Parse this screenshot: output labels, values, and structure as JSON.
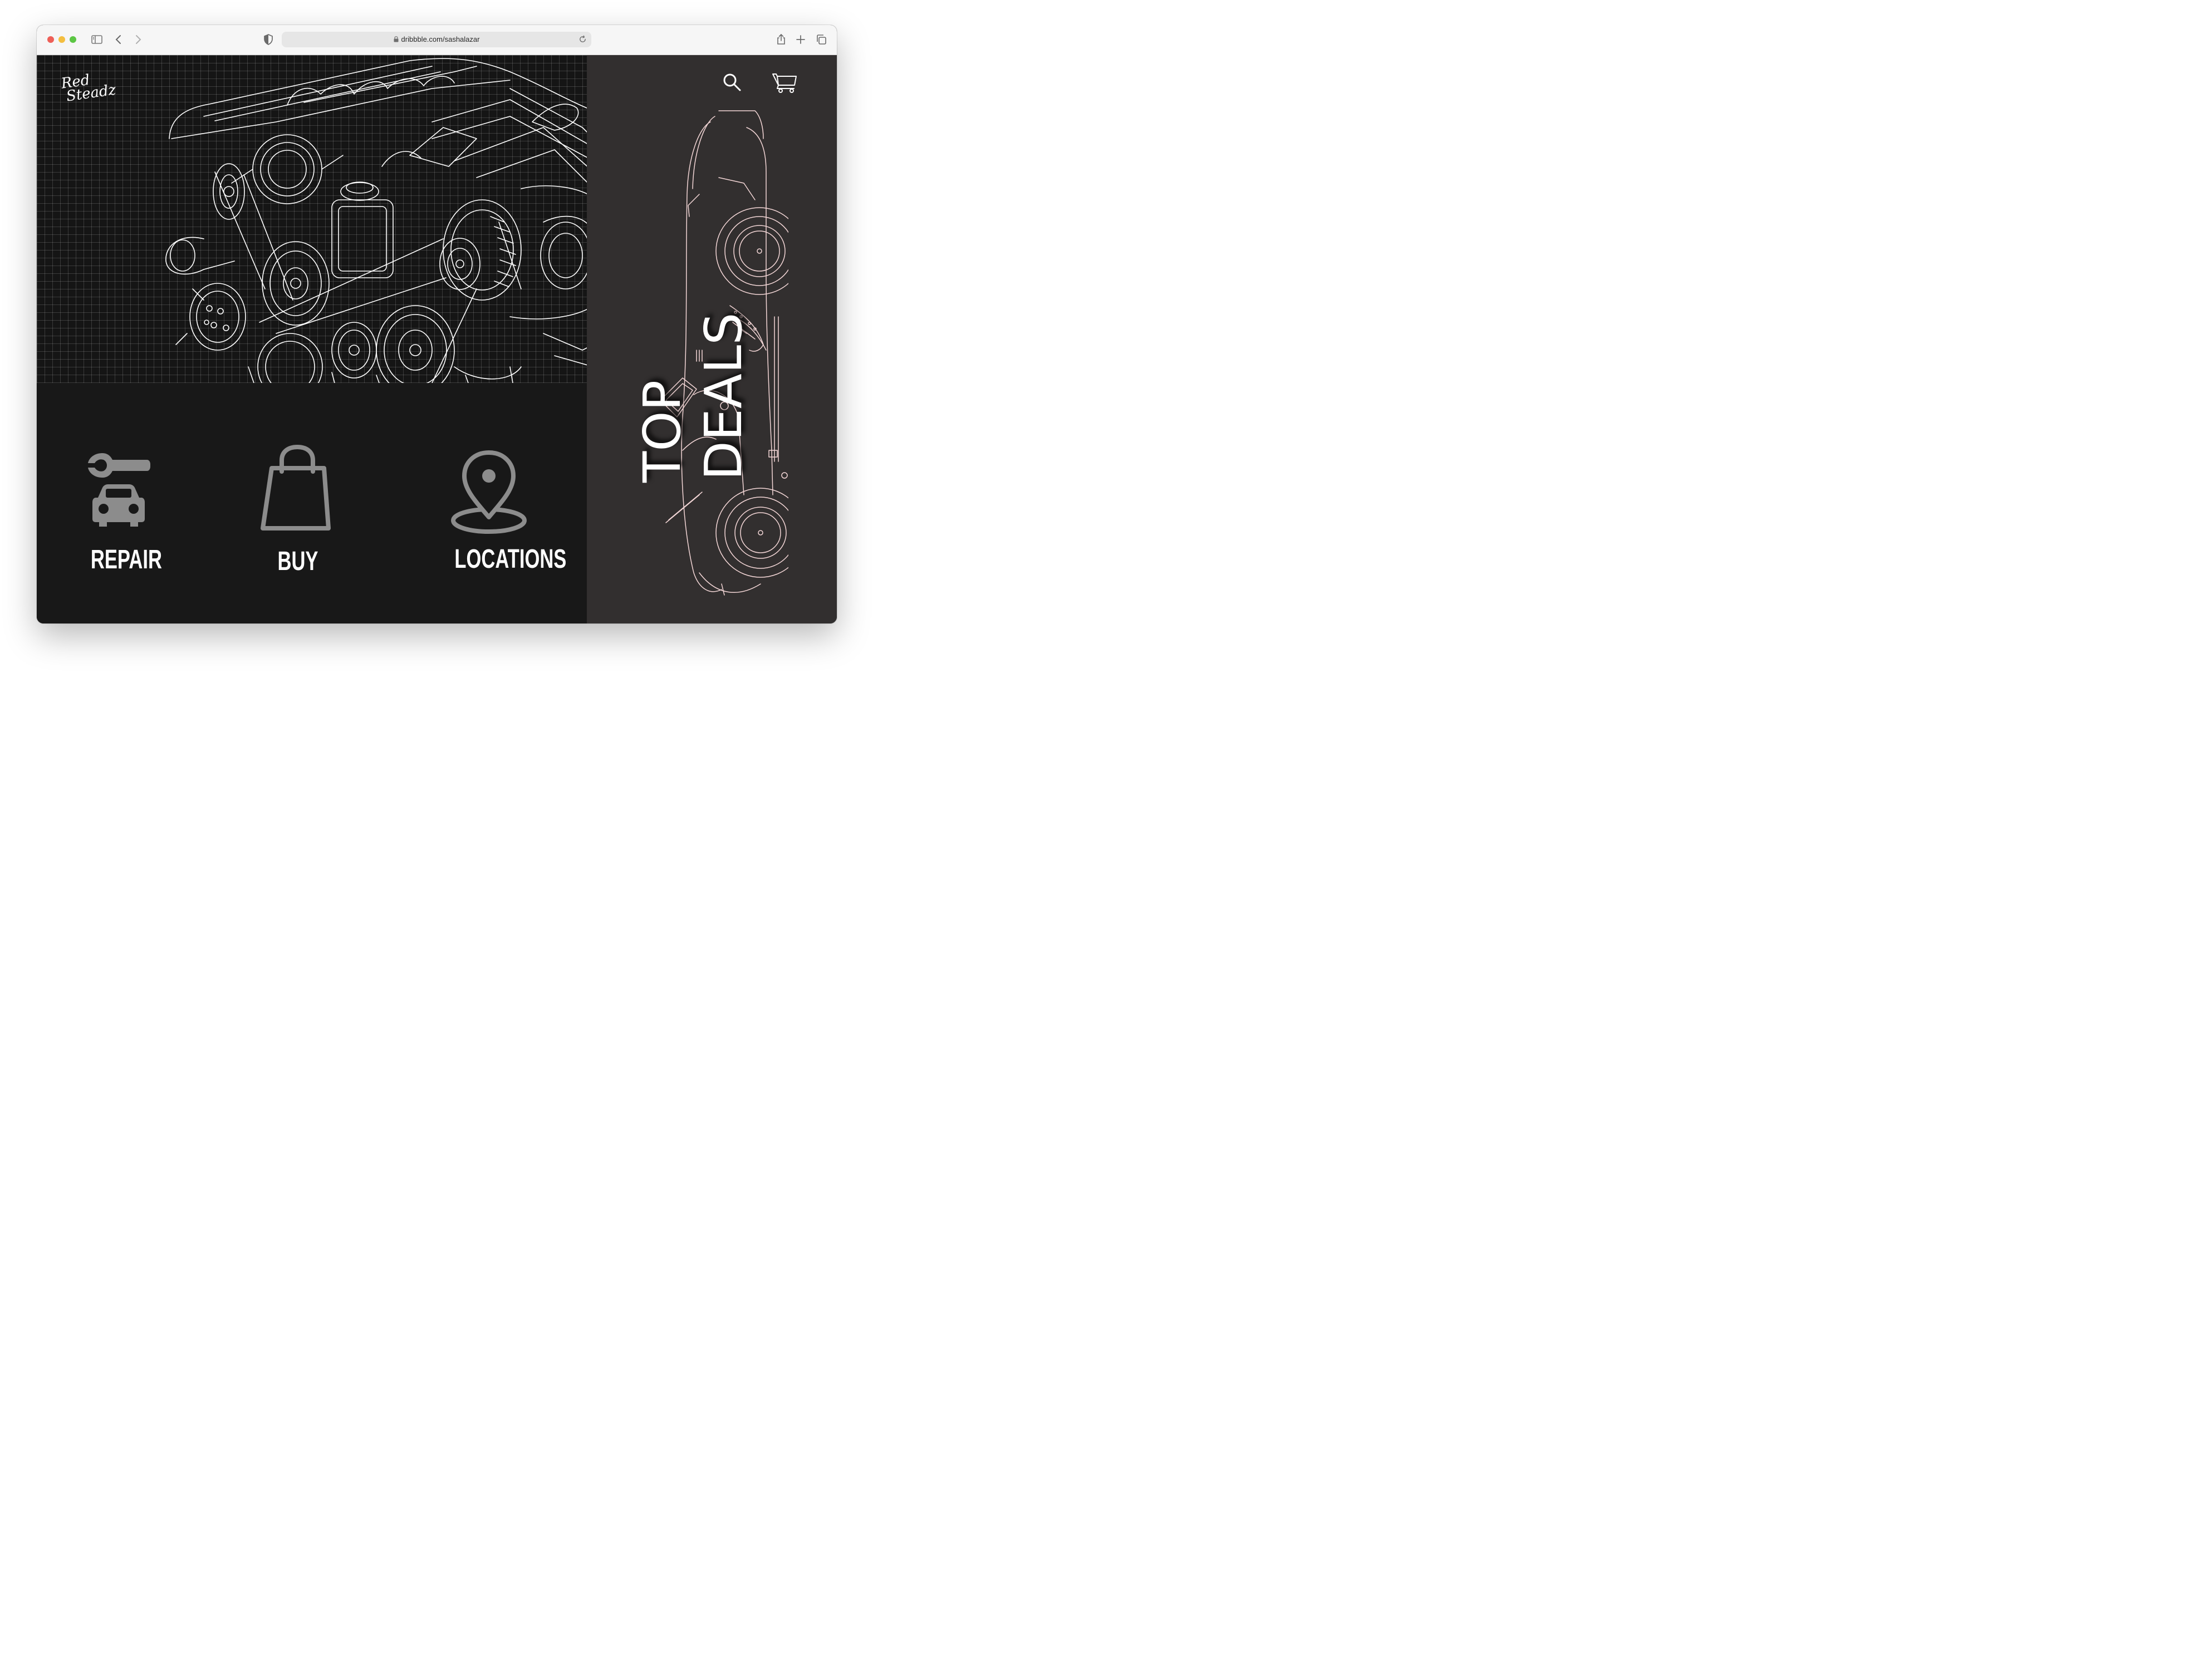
{
  "browser": {
    "url": "dribbble.com/sashalazar"
  },
  "brand": {
    "line1": "Red",
    "line2": "Steadz"
  },
  "nav": [
    {
      "label": "REPAIR",
      "icon": "wrench-car-icon"
    },
    {
      "label": "BUY",
      "icon": "shopping-bag-icon"
    },
    {
      "label": "LOCATIONS",
      "icon": "map-pin-icon"
    }
  ],
  "promo": {
    "line1": "TOP",
    "line2": "DEALS"
  },
  "header_icons": [
    "search-icon",
    "cart-icon"
  ],
  "colors": {
    "hero_bg": "#151515",
    "lower_bg": "#181818",
    "side_panel_bg": "#322f2f",
    "icon_gray": "#8c8c8c",
    "coupe_line": "#f3d6d6",
    "text": "#ffffff"
  }
}
